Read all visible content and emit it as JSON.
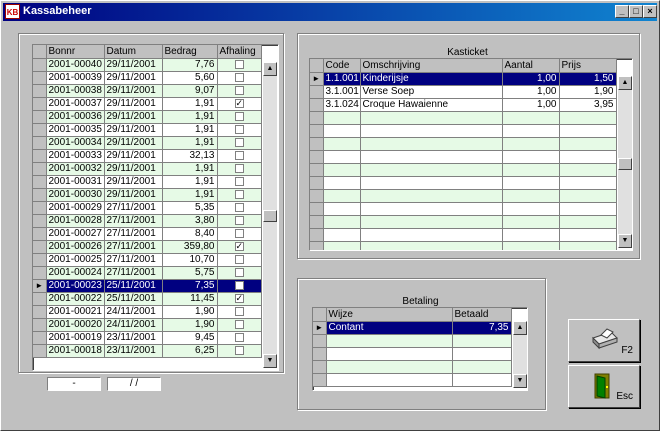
{
  "window": {
    "title": "Kassabeheer",
    "minimize": "_",
    "maximize": "□",
    "close": "×"
  },
  "bonnen": {
    "headers": [
      "Bonnr",
      "Datum",
      "Bedrag",
      "Afhaling"
    ],
    "rows": [
      {
        "bonnr": "2001-00040",
        "datum": "29/11/2001",
        "bedrag": "7,76",
        "afhaling": false
      },
      {
        "bonnr": "2001-00039",
        "datum": "29/11/2001",
        "bedrag": "5,60",
        "afhaling": false
      },
      {
        "bonnr": "2001-00038",
        "datum": "29/11/2001",
        "bedrag": "9,07",
        "afhaling": false
      },
      {
        "bonnr": "2001-00037",
        "datum": "29/11/2001",
        "bedrag": "1,91",
        "afhaling": true
      },
      {
        "bonnr": "2001-00036",
        "datum": "29/11/2001",
        "bedrag": "1,91",
        "afhaling": false
      },
      {
        "bonnr": "2001-00035",
        "datum": "29/11/2001",
        "bedrag": "1,91",
        "afhaling": false
      },
      {
        "bonnr": "2001-00034",
        "datum": "29/11/2001",
        "bedrag": "1,91",
        "afhaling": false
      },
      {
        "bonnr": "2001-00033",
        "datum": "29/11/2001",
        "bedrag": "32,13",
        "afhaling": false
      },
      {
        "bonnr": "2001-00032",
        "datum": "29/11/2001",
        "bedrag": "1,91",
        "afhaling": false
      },
      {
        "bonnr": "2001-00031",
        "datum": "29/11/2001",
        "bedrag": "1,91",
        "afhaling": false
      },
      {
        "bonnr": "2001-00030",
        "datum": "29/11/2001",
        "bedrag": "1,91",
        "afhaling": false
      },
      {
        "bonnr": "2001-00029",
        "datum": "27/11/2001",
        "bedrag": "5,35",
        "afhaling": false
      },
      {
        "bonnr": "2001-00028",
        "datum": "27/11/2001",
        "bedrag": "3,80",
        "afhaling": false
      },
      {
        "bonnr": "2001-00027",
        "datum": "27/11/2001",
        "bedrag": "8,40",
        "afhaling": false
      },
      {
        "bonnr": "2001-00026",
        "datum": "27/11/2001",
        "bedrag": "359,80",
        "afhaling": true
      },
      {
        "bonnr": "2001-00025",
        "datum": "27/11/2001",
        "bedrag": "10,70",
        "afhaling": false
      },
      {
        "bonnr": "2001-00024",
        "datum": "27/11/2001",
        "bedrag": "5,75",
        "afhaling": false
      },
      {
        "bonnr": "2001-00023",
        "datum": "25/11/2001",
        "bedrag": "7,35",
        "afhaling": false,
        "selected": true
      },
      {
        "bonnr": "2001-00022",
        "datum": "25/11/2001",
        "bedrag": "11,45",
        "afhaling": true
      },
      {
        "bonnr": "2001-00021",
        "datum": "24/11/2001",
        "bedrag": "1,90",
        "afhaling": false
      },
      {
        "bonnr": "2001-00020",
        "datum": "24/11/2001",
        "bedrag": "1,90",
        "afhaling": false
      },
      {
        "bonnr": "2001-00019",
        "datum": "23/11/2001",
        "bedrag": "9,45",
        "afhaling": false
      },
      {
        "bonnr": "2001-00018",
        "datum": "23/11/2001",
        "bedrag": "6,25",
        "afhaling": false
      }
    ]
  },
  "filters": {
    "bonnr_mask": " -",
    "datum_mask": " / /"
  },
  "kasticket": {
    "title": "Kasticket",
    "headers": [
      "Code",
      "Omschrijving",
      "Aantal",
      "Prijs"
    ],
    "rows": [
      {
        "code": "1.1.001",
        "omschrijving": "Kinderijsje",
        "aantal": "1,00",
        "prijs": "1,50",
        "selected": true
      },
      {
        "code": "3.1.001",
        "omschrijving": "Verse Soep",
        "aantal": "1,00",
        "prijs": "1,90"
      },
      {
        "code": "3.1.024",
        "omschrijving": "Croque Hawaienne",
        "aantal": "1,00",
        "prijs": "3,95"
      }
    ],
    "empty_rows": 11
  },
  "betaling": {
    "title": "Betaling",
    "headers": [
      "Wijze",
      "Betaald"
    ],
    "rows": [
      {
        "wijze": "Contant",
        "betaald": "7,35",
        "selected": true
      }
    ],
    "empty_rows": 4
  },
  "buttons": {
    "print_key": "F2",
    "exit_key": "Esc"
  },
  "colors": {
    "title_start": "#000080",
    "title_end": "#1084d0",
    "row_green": "#e6fae6",
    "selection": "#000080",
    "face": "#c0c0c0"
  },
  "icons": {
    "print": "printer-icon",
    "exit": "door-exit-icon",
    "row_pointer": "arrow-right-icon"
  }
}
